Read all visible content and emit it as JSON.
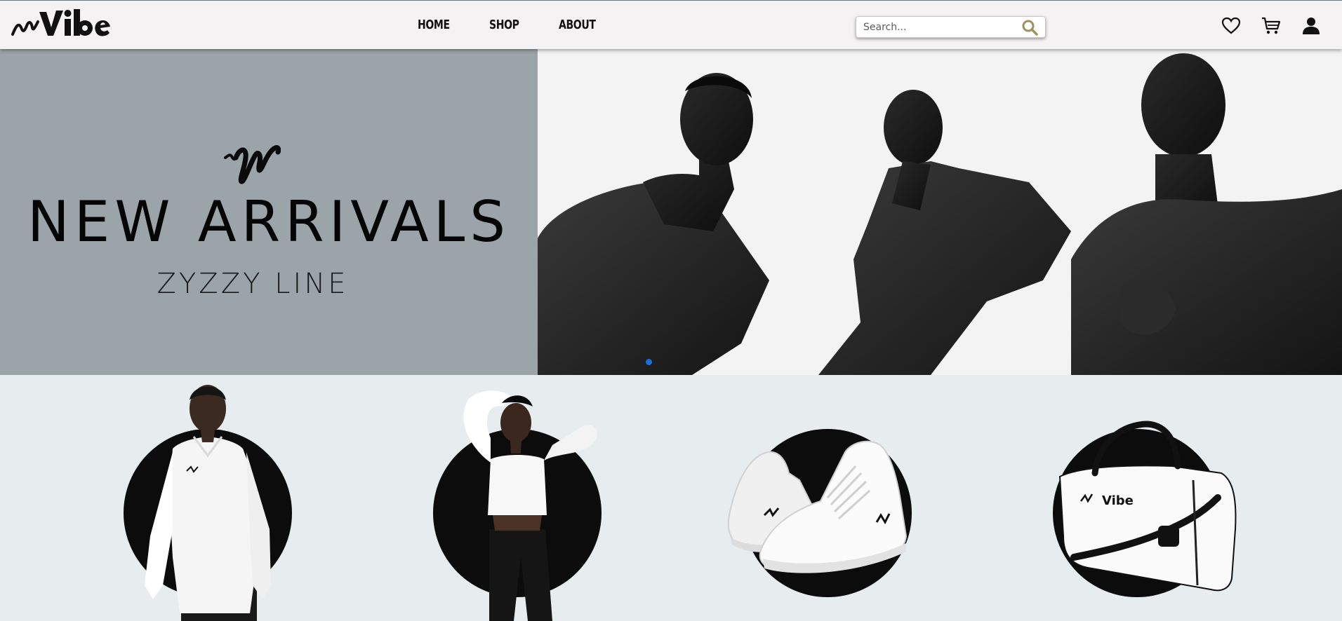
{
  "brand": {
    "name": "Vibe",
    "mark": "W"
  },
  "nav": {
    "items": [
      {
        "label": "HOME"
      },
      {
        "label": "SHOP"
      },
      {
        "label": "ABOUT"
      }
    ]
  },
  "search": {
    "placeholder": "Search...",
    "value": ""
  },
  "header_icons": [
    "heart-icon",
    "cart-icon",
    "user-icon"
  ],
  "hero": {
    "title": "NEW ARRIVALS",
    "subtitle": "ZYZZY LINE",
    "background_color": "#9ba5a9",
    "active_slide": 1
  },
  "products": [
    {
      "name": "polo-shirt"
    },
    {
      "name": "long-sleeve-crop-top"
    },
    {
      "name": "high-top-sneakers"
    },
    {
      "name": "duffel-bag"
    }
  ],
  "colors": {
    "header_bg": "#f4f2f3",
    "page_bg": "#e7edef",
    "search_icon": "#9c9362",
    "carousel_dot": "#1d6ed8"
  }
}
